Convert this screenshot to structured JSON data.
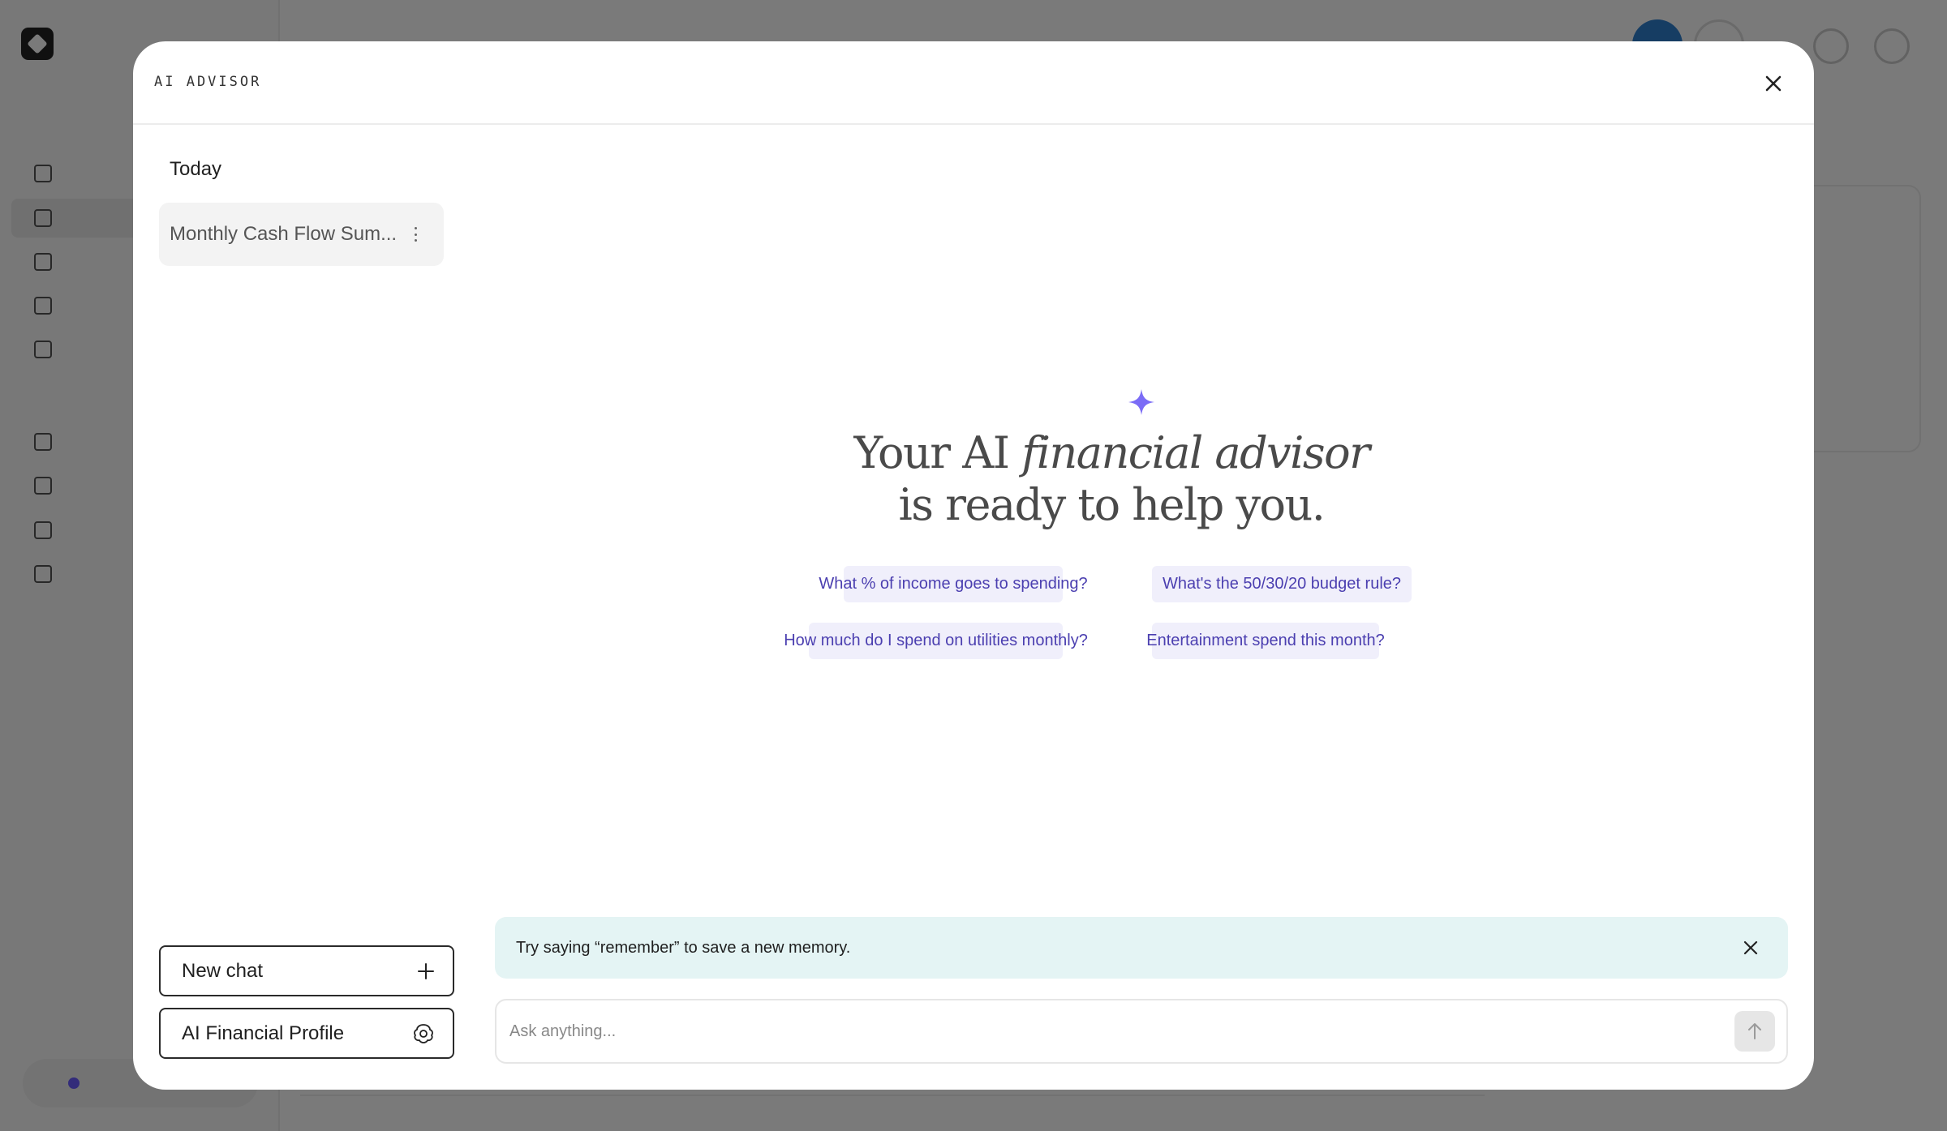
{
  "modal": {
    "title": "AI ADVISOR",
    "sidebar": {
      "heading": "Today",
      "chats": [
        {
          "label": "Monthly Cash Flow Sum..."
        }
      ],
      "new_chat_label": "New chat",
      "profile_label": "AI Financial Profile"
    },
    "hero": {
      "line1_prefix": "Your AI ",
      "line1_emphasis": "financial advisor",
      "line2": "is ready to help you.",
      "accent_color": "#7b6cf6"
    },
    "suggestions": [
      "What % of income goes to spending?",
      "What's the 50/30/20 budget rule?",
      "How much do I spend on utilities monthly?",
      "Entertainment spend this month?"
    ],
    "tip": "Try saying “remember” to save a new memory.",
    "composer": {
      "placeholder": "Ask anything..."
    }
  },
  "colors": {
    "chip_bg": "#f0effb",
    "chip_text": "#4b3fb0",
    "tip_bg": "#e4f4f4"
  }
}
